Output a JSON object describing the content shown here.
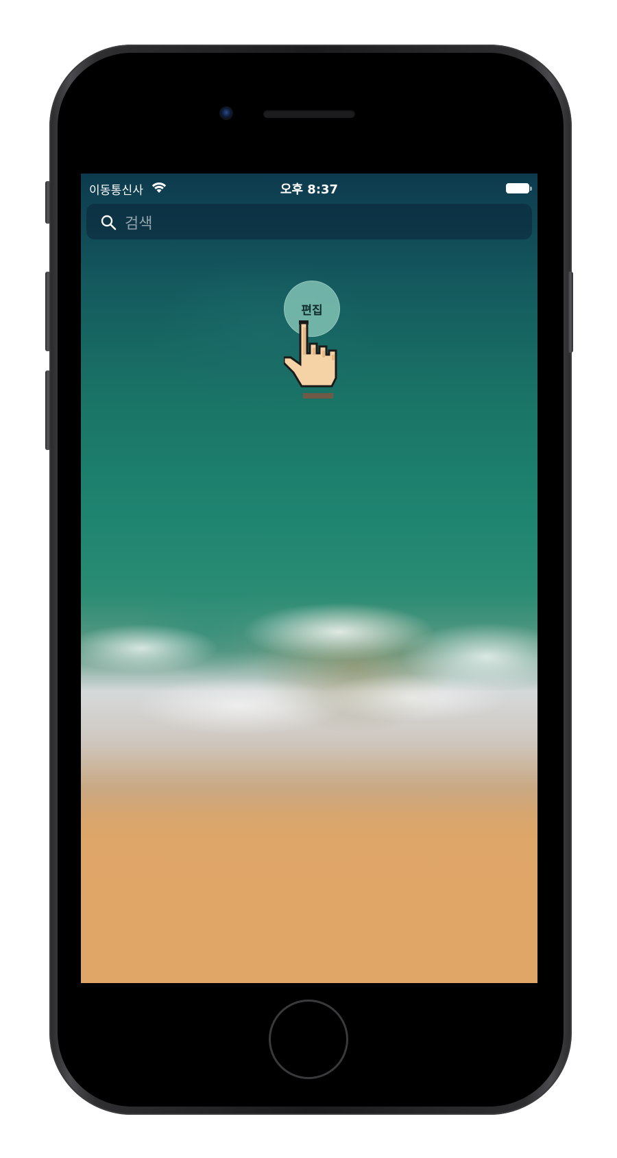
{
  "status_bar": {
    "carrier": "이동통신사",
    "time": "오후 8:37"
  },
  "search": {
    "placeholder": "검색"
  },
  "edit_button": {
    "label": "편집"
  },
  "icons": {
    "wifi": "wifi-icon",
    "battery": "battery-icon",
    "search": "search-icon",
    "cursor": "hand-cursor-icon"
  },
  "colors": {
    "phone_frame": "#2a2a2c",
    "edit_button_bg": "#7dbeb0",
    "ocean": "#1a7466",
    "sand": "#dfa668"
  }
}
